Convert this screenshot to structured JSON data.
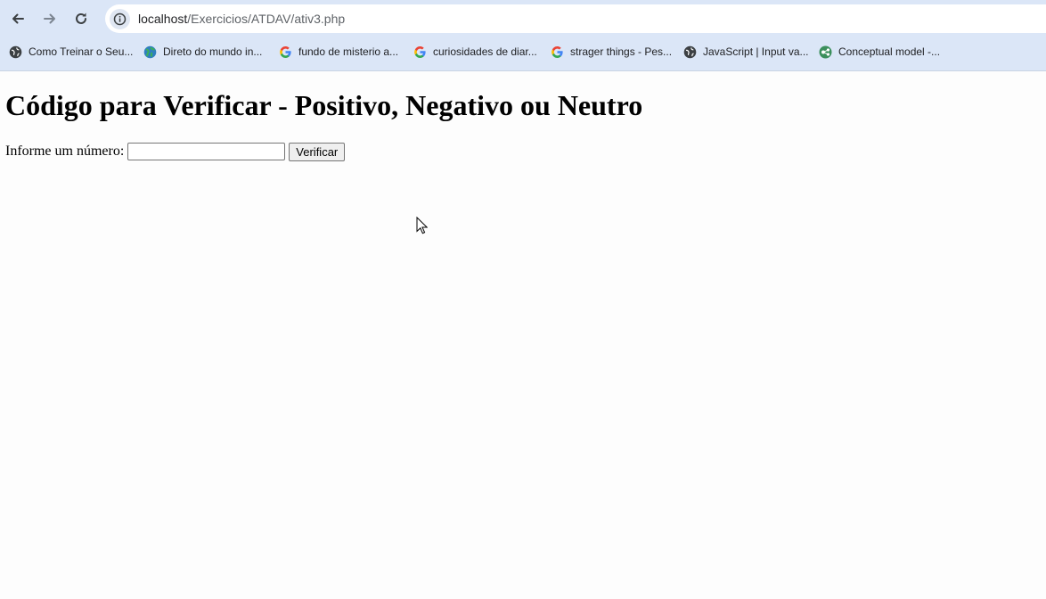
{
  "browser": {
    "url_host": "localhost",
    "url_path": "/Exercicios/ATDAV/ativ3.php",
    "bookmarks": [
      {
        "label": "Como Treinar o Seu...",
        "icon": "globe-icon"
      },
      {
        "label": "Direto do mundo in...",
        "icon": "earth-icon"
      },
      {
        "label": "fundo de misterio a...",
        "icon": "google-icon"
      },
      {
        "label": "curiosidades de diar...",
        "icon": "google-icon"
      },
      {
        "label": "strager things - Pes...",
        "icon": "google-icon"
      },
      {
        "label": "JavaScript | Input va...",
        "icon": "globe-icon"
      },
      {
        "label": "Conceptual model -...",
        "icon": "lucidchart-icon"
      }
    ]
  },
  "page": {
    "title": "Código para Verificar - Positivo, Negativo ou Neutro",
    "form": {
      "label": "Informe um número:",
      "input_value": "",
      "button_label": "Verificar"
    }
  },
  "colors": {
    "chrome_bg": "#dbe6f7",
    "page_bg": "#fdfdfd",
    "google_blue": "#4285F4",
    "google_red": "#EA4335",
    "google_yellow": "#FBBC05",
    "google_green": "#34A853"
  }
}
